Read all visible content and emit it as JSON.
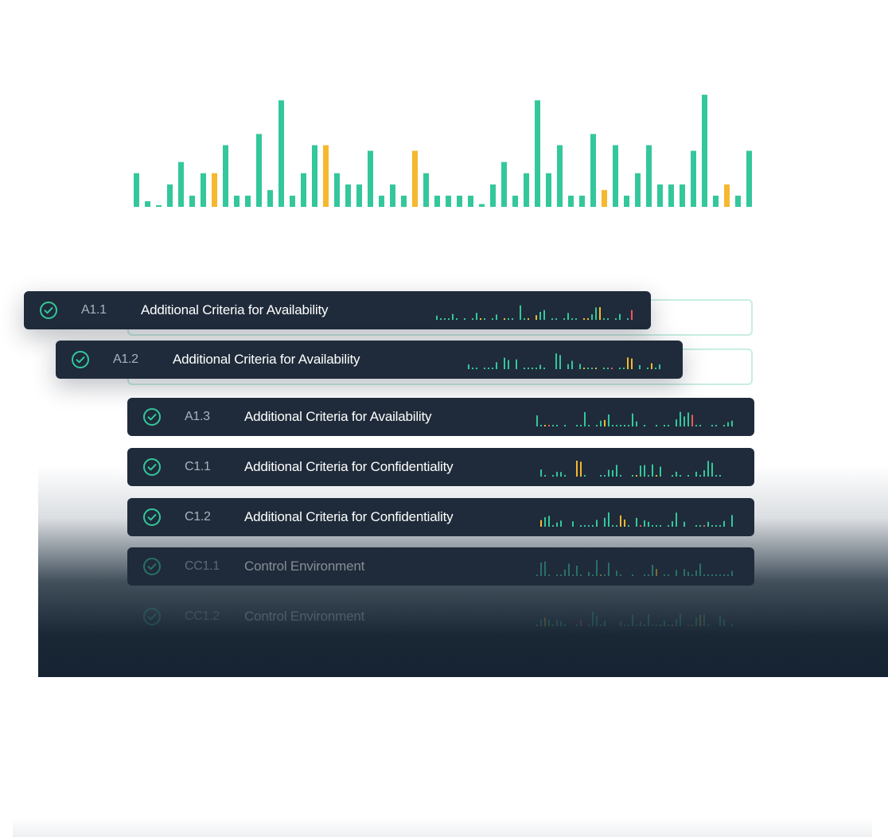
{
  "colors": {
    "green": "#34c79c",
    "amber": "#f5b82e",
    "red": "#f0565e",
    "row_bg": "#1f2b3a"
  },
  "chart_data": {
    "type": "bar",
    "values": [
      6,
      1,
      0.3,
      4,
      8,
      2,
      6,
      6,
      11,
      2,
      2,
      13,
      3,
      19,
      2,
      6,
      11,
      11,
      6,
      4,
      4,
      10,
      2,
      4,
      2,
      10,
      6,
      2,
      2,
      2,
      2,
      0.5,
      4,
      8,
      2,
      6,
      19,
      6,
      11,
      2,
      2,
      13,
      3,
      11,
      2,
      6,
      11,
      4,
      4,
      4,
      10,
      20,
      2,
      4,
      2,
      10
    ],
    "highlight": {
      "7": "amber",
      "17": "amber",
      "25": "amber",
      "42": "amber",
      "53": "amber"
    }
  },
  "rows": [
    {
      "code": "A1.1",
      "title": "Additional Criteria for Availability",
      "icon": "check-circle-icon"
    },
    {
      "code": "A1.2",
      "title": "Additional Criteria for Availability",
      "icon": "check-circle-icon"
    },
    {
      "code": "A1.3",
      "title": "Additional Criteria for Availability",
      "icon": "check-circle-icon"
    },
    {
      "code": "C1.1",
      "title": "Additional Criteria for Confidentiality",
      "icon": "check-circle-icon"
    },
    {
      "code": "C1.2",
      "title": "Additional Criteria for Confidentiality",
      "icon": "check-circle-icon"
    },
    {
      "code": "CC1.1",
      "title": "Control Environment",
      "icon": "check-circle-icon"
    },
    {
      "code": "CC1.2",
      "title": "Control Environment",
      "icon": "check-circle-icon"
    }
  ]
}
